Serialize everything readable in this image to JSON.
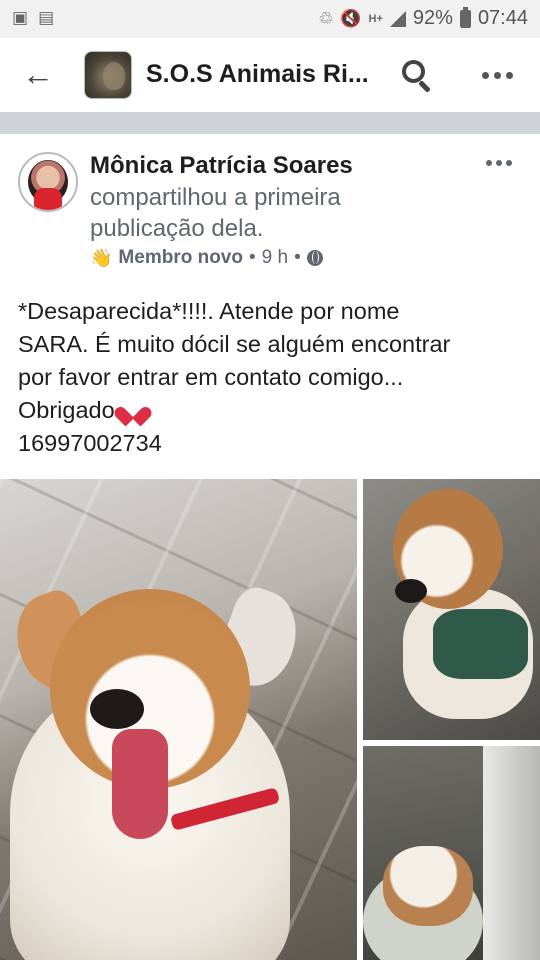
{
  "status_bar": {
    "battery": "92%",
    "time": "07:44",
    "network": "H+"
  },
  "header": {
    "title": "S.O.S Animais Ri..."
  },
  "post": {
    "author": "Mônica Patrícia Soares",
    "shared_text": "compartilhou a primeira publicação dela.",
    "badge": "Membro novo",
    "separator": "•",
    "time": "9 h",
    "body_lines": [
      "*Desaparecida*!!!!. Atende por nome",
      "SARA. É muito dócil se alguém encontrar",
      "por favor entrar em contato comigo...",
      "Obrigado",
      "16997002734"
    ]
  },
  "icons": {
    "back": "arrow-left-icon",
    "search": "search-icon",
    "more": "more-horizontal-icon",
    "globe": "globe-icon",
    "wave": "waving-hand-icon",
    "heart": "broken-heart-icon"
  },
  "colors": {
    "divider": "#cfd2d7",
    "secondary_text": "#606770",
    "primary_text": "#1c1e21"
  }
}
